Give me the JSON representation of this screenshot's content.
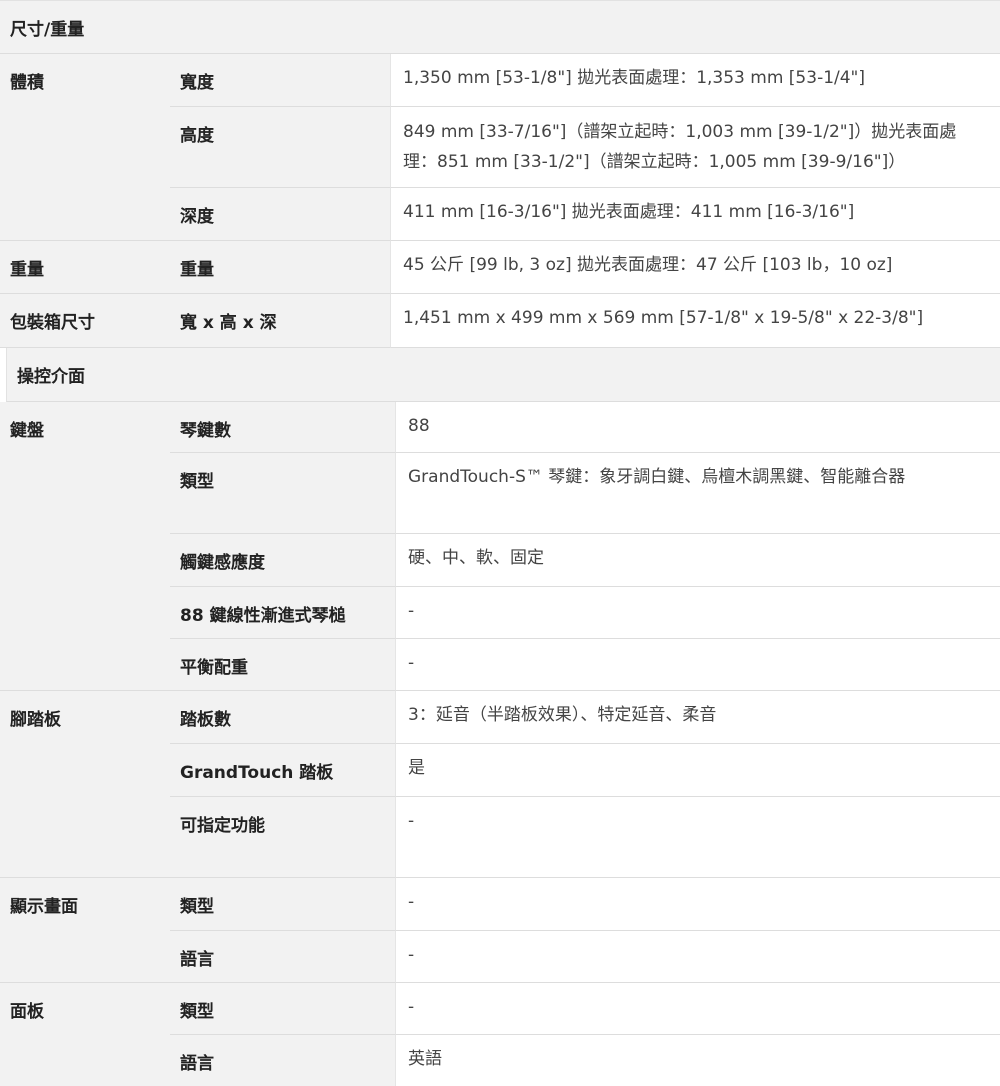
{
  "sections": {
    "size": {
      "title": "尺寸/重量",
      "groups": [
        {
          "category": "體積",
          "rows": [
            {
              "label": "寬度",
              "value": "1,350 mm [53-1/8\"] 拋光表面處理：1,353 mm [53-1/4\"]"
            },
            {
              "label": "高度",
              "value": "849 mm [33-7/16\"]（譜架立起時：1,003 mm [39-1/2\"]）拋光表面處理：851 mm [33-1/2\"]（譜架立起時：1,005 mm [39-9/16\"]）"
            },
            {
              "label": "深度",
              "value": "411 mm [16-3/16\"] 拋光表面處理：411 mm [16-3/16\"]"
            }
          ]
        },
        {
          "category": "重量",
          "rows": [
            {
              "label": "重量",
              "value": "45 公斤 [99 lb, 3 oz] 拋光表面處理：47 公斤 [103 lb，10 oz]"
            }
          ]
        },
        {
          "category": "包裝箱尺寸",
          "rows": [
            {
              "label": "寬 x 高 x 深",
              "value": "1,451 mm x 499 mm x 569 mm [57-1/8\" x 19-5/8\" x 22-3/8\"]"
            }
          ]
        }
      ]
    },
    "controls": {
      "title": "操控介面",
      "groups": [
        {
          "category": "鍵盤",
          "rows": [
            {
              "label": "琴鍵數",
              "value": "88"
            },
            {
              "label": "類型",
              "value": "GrandTouch-S™ 琴鍵：象牙調白鍵、烏檀木調黑鍵、智能離合器"
            },
            {
              "label": "觸鍵感應度",
              "value": "硬、中、軟、固定"
            },
            {
              "label": "88 鍵線性漸進式琴槌",
              "value": "-"
            },
            {
              "label": "平衡配重",
              "value": "-"
            }
          ]
        },
        {
          "category": "腳踏板",
          "rows": [
            {
              "label": "踏板數",
              "value": "3：延音（半踏板效果）、特定延音、柔音"
            },
            {
              "label": "GrandTouch 踏板",
              "value": "是"
            },
            {
              "label": "可指定功能",
              "value": "-"
            }
          ]
        },
        {
          "category": "顯示畫面",
          "rows": [
            {
              "label": "類型",
              "value": "-"
            },
            {
              "label": "語言",
              "value": "-"
            }
          ]
        },
        {
          "category": "面板",
          "rows": [
            {
              "label": "類型",
              "value": "-"
            },
            {
              "label": "語言",
              "value": "英語"
            }
          ]
        }
      ]
    }
  }
}
